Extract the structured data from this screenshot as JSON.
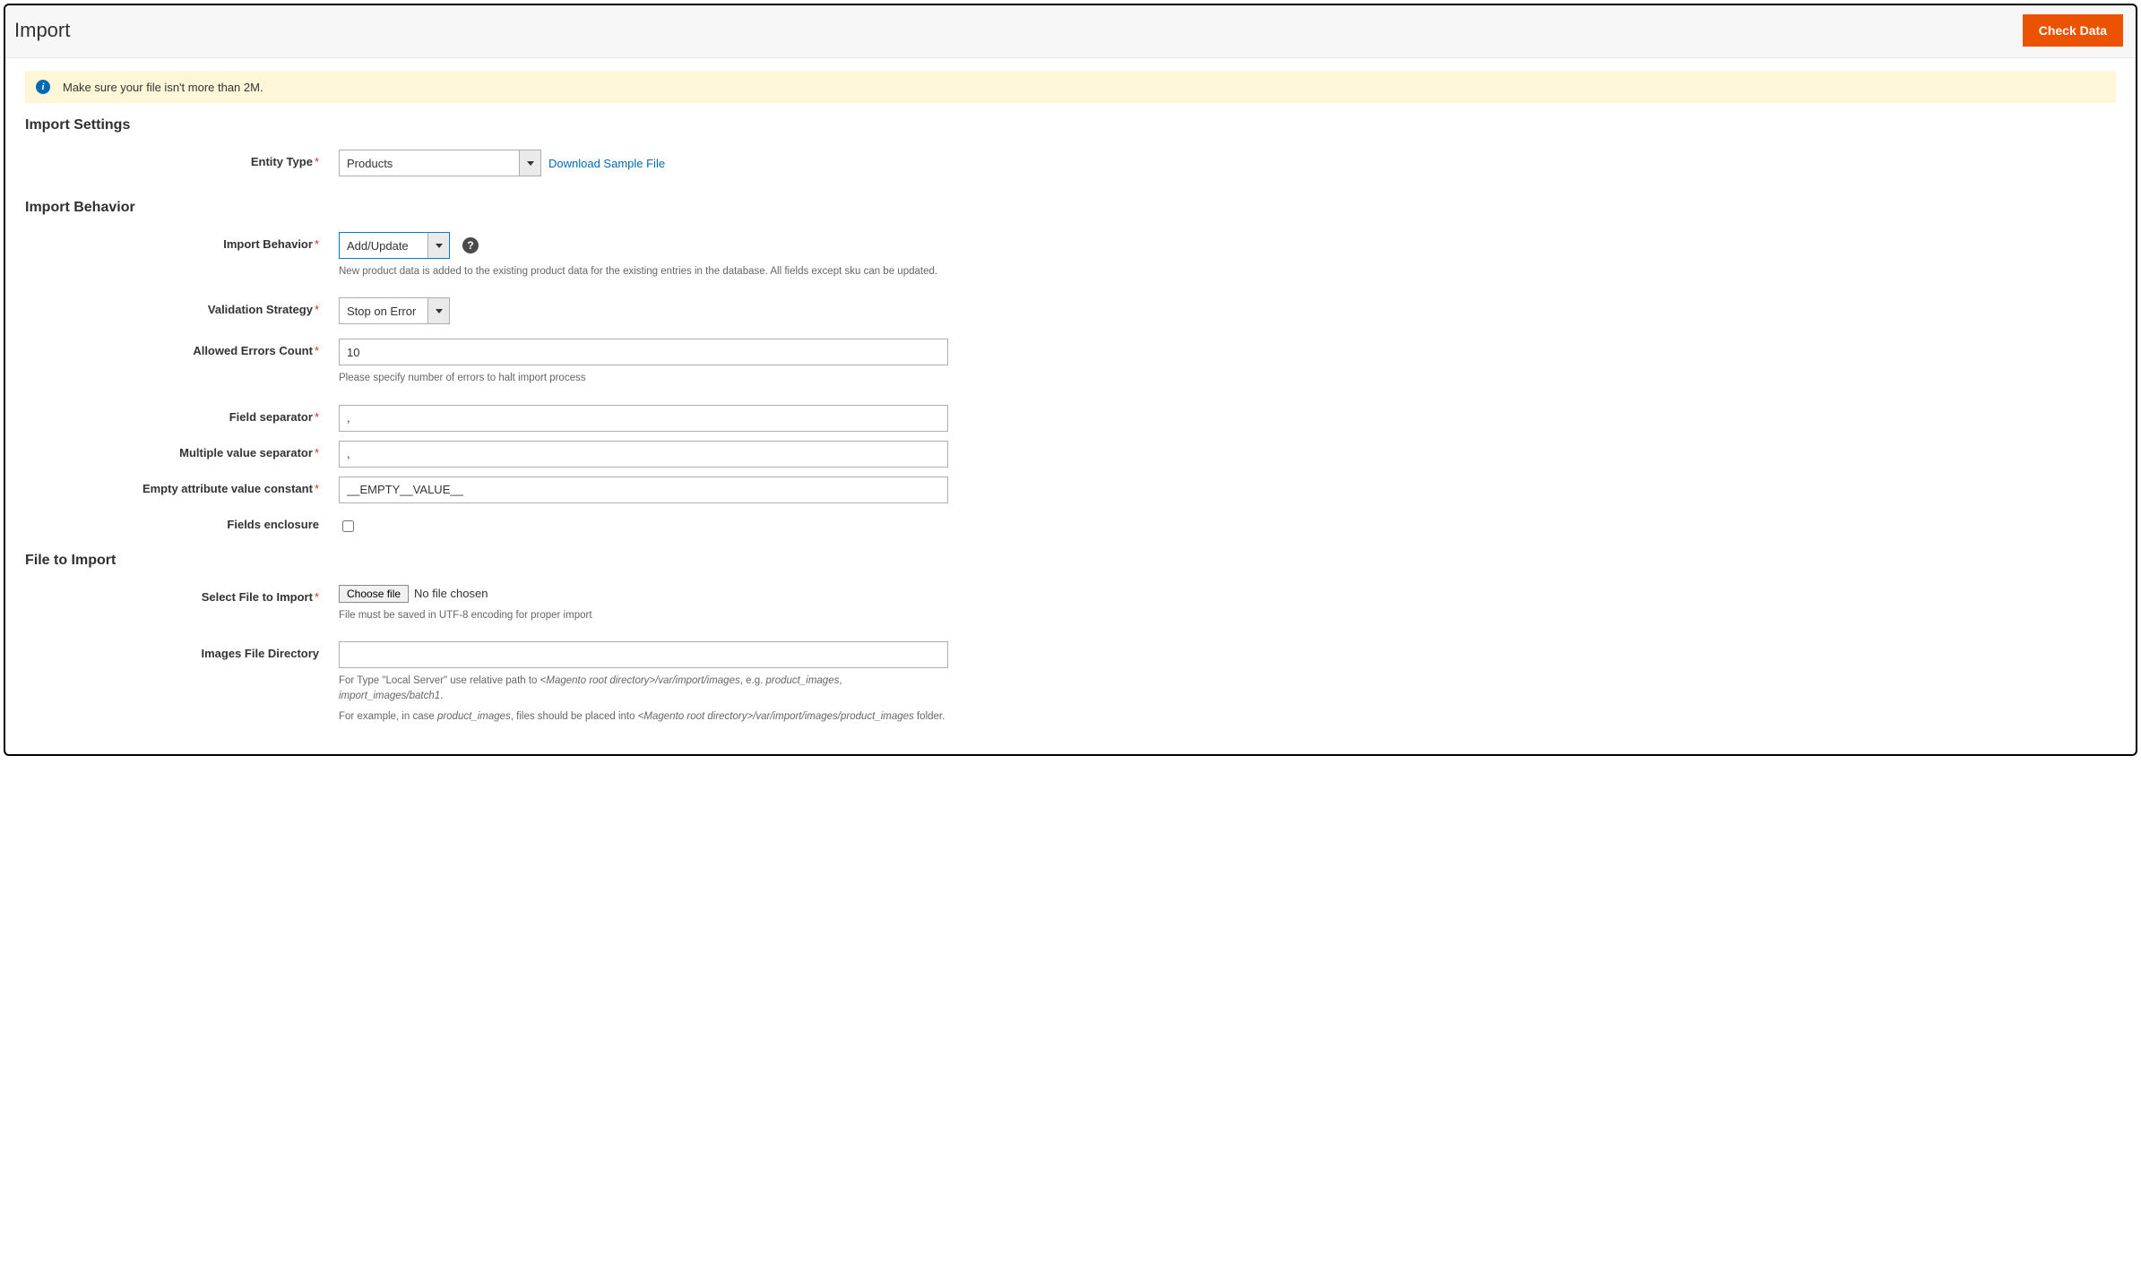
{
  "header": {
    "title": "Import",
    "check_data_button": "Check Data"
  },
  "message": {
    "text": "Make sure your file isn't more than 2M."
  },
  "sections": {
    "import_settings": {
      "title": "Import Settings",
      "entity_type": {
        "label": "Entity Type",
        "value": "Products",
        "sample_link": "Download Sample File"
      }
    },
    "import_behavior": {
      "title": "Import Behavior",
      "behavior": {
        "label": "Import Behavior",
        "value": "Add/Update",
        "note": "New product data is added to the existing product data for the existing entries in the database. All fields except sku can be updated."
      },
      "validation_strategy": {
        "label": "Validation Strategy",
        "value": "Stop on Error"
      },
      "allowed_errors": {
        "label": "Allowed Errors Count",
        "value": "10",
        "note": "Please specify number of errors to halt import process"
      },
      "field_separator": {
        "label": "Field separator",
        "value": ","
      },
      "multi_value_separator": {
        "label": "Multiple value separator",
        "value": ","
      },
      "empty_attribute": {
        "label": "Empty attribute value constant",
        "value": "__EMPTY__VALUE__"
      },
      "fields_enclosure": {
        "label": "Fields enclosure"
      }
    },
    "file_to_import": {
      "title": "File to Import",
      "select_file": {
        "label": "Select File to Import",
        "button": "Choose file",
        "status": "No file chosen",
        "note": "File must be saved in UTF-8 encoding for proper import"
      },
      "images_dir": {
        "label": "Images File Directory",
        "value": "",
        "note1_prefix": "For Type \"Local Server\" use relative path to ",
        "note1_em1": "<Magento root directory>/var/import/images",
        "note1_mid": ", e.g. ",
        "note1_em2": "product_images",
        "note1_sep": ", ",
        "note1_em3": "import_images/batch1",
        "note1_suffix": ".",
        "note2_prefix": "For example, in case ",
        "note2_em1": "product_images",
        "note2_mid": ", files should be placed into ",
        "note2_em2": "<Magento root directory>/var/import/images/product_images",
        "note2_suffix": " folder."
      }
    }
  }
}
